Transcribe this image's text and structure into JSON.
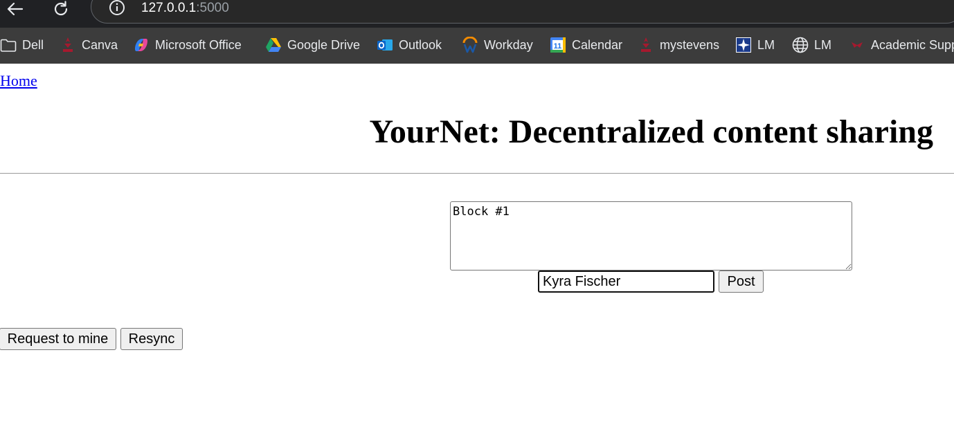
{
  "browser": {
    "url_host": "127.0.0.1",
    "url_port": ":5000",
    "bookmarks": [
      {
        "label": "Dell",
        "icon": "folder-icon"
      },
      {
        "label": "Canva",
        "icon": "stevens-logo-icon"
      },
      {
        "label": "Microsoft Office",
        "icon": "microsoft-copilot-icon"
      },
      {
        "label": "Google Drive",
        "icon": "google-drive-icon"
      },
      {
        "label": "Outlook",
        "icon": "outlook-icon"
      },
      {
        "label": "Workday",
        "icon": "workday-icon"
      },
      {
        "label": "Calendar",
        "icon": "google-calendar-icon"
      },
      {
        "label": "mystevens",
        "icon": "stevens-logo-icon"
      },
      {
        "label": "LM",
        "icon": "lockheed-star-icon"
      },
      {
        "label": "LM",
        "icon": "globe-icon"
      },
      {
        "label": "Academic Supp",
        "icon": "academic-support-icon"
      }
    ],
    "calendar_day": "11"
  },
  "page": {
    "home_link": "Home",
    "title": "YourNet: Decentralized content sharing",
    "content_value": "Block #1",
    "author_value": "Kyra Fischer",
    "post_label": "Post",
    "mine_label": "Request to mine",
    "resync_label": "Resync"
  },
  "colors": {
    "link": "#0000ee",
    "chrome_bg": "#3c3c3c",
    "button_bg": "#efefef"
  }
}
